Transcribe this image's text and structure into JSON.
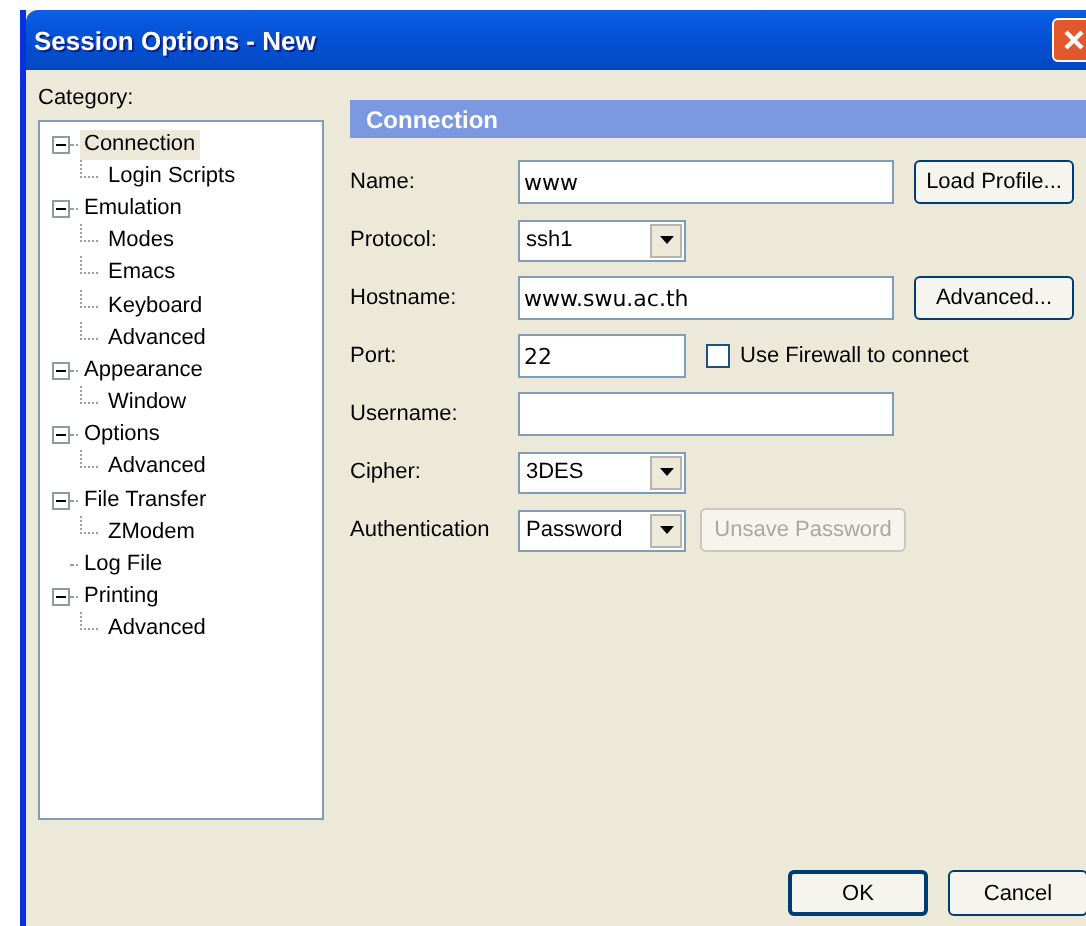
{
  "window": {
    "title": "Session Options - New"
  },
  "category": {
    "label": "Category:",
    "items": [
      {
        "label": "Connection",
        "selected": true,
        "expanded": true,
        "children": [
          {
            "label": "Login Scripts",
            "selected": false
          }
        ]
      },
      {
        "label": "Emulation",
        "selected": false,
        "expanded": true,
        "children": [
          {
            "label": "Modes",
            "selected": false
          },
          {
            "label": "Emacs",
            "selected": false
          },
          {
            "label": "Keyboard",
            "selected": false
          },
          {
            "label": "Advanced",
            "selected": false
          }
        ]
      },
      {
        "label": "Appearance",
        "selected": false,
        "expanded": true,
        "children": [
          {
            "label": "Window",
            "selected": false
          }
        ]
      },
      {
        "label": "Options",
        "selected": false,
        "expanded": true,
        "children": [
          {
            "label": "Advanced",
            "selected": false
          }
        ]
      },
      {
        "label": "File Transfer",
        "selected": false,
        "expanded": true,
        "children": [
          {
            "label": "ZModem",
            "selected": false
          }
        ]
      },
      {
        "label": "Log File",
        "selected": false
      },
      {
        "label": "Printing",
        "selected": false,
        "expanded": true,
        "children": [
          {
            "label": "Advanced",
            "selected": false
          }
        ]
      }
    ]
  },
  "panel": {
    "title": "Connection",
    "fields": [
      {
        "label": "Name:",
        "kind": "text",
        "value": "www",
        "button": {
          "label": "Load Profile...",
          "disabled": false
        }
      },
      {
        "label": "Protocol:",
        "kind": "select",
        "value": "ssh1"
      },
      {
        "label": "Hostname:",
        "kind": "text",
        "value": "www.swu.ac.th",
        "button": {
          "label": "Advanced...",
          "disabled": false
        }
      },
      {
        "label": "Port:",
        "kind": "number",
        "value": "22",
        "checkbox": {
          "label": "Use Firewall to connect",
          "checked": false
        }
      },
      {
        "label": "Username:",
        "kind": "text"
      },
      {
        "label": "Cipher:",
        "kind": "select",
        "value": "3DES"
      },
      {
        "label": "Authentication",
        "kind": "select",
        "value": "Password",
        "button": {
          "label": "Unsave Password",
          "disabled": true
        }
      }
    ]
  },
  "buttons": [
    "OK",
    "Cancel"
  ]
}
